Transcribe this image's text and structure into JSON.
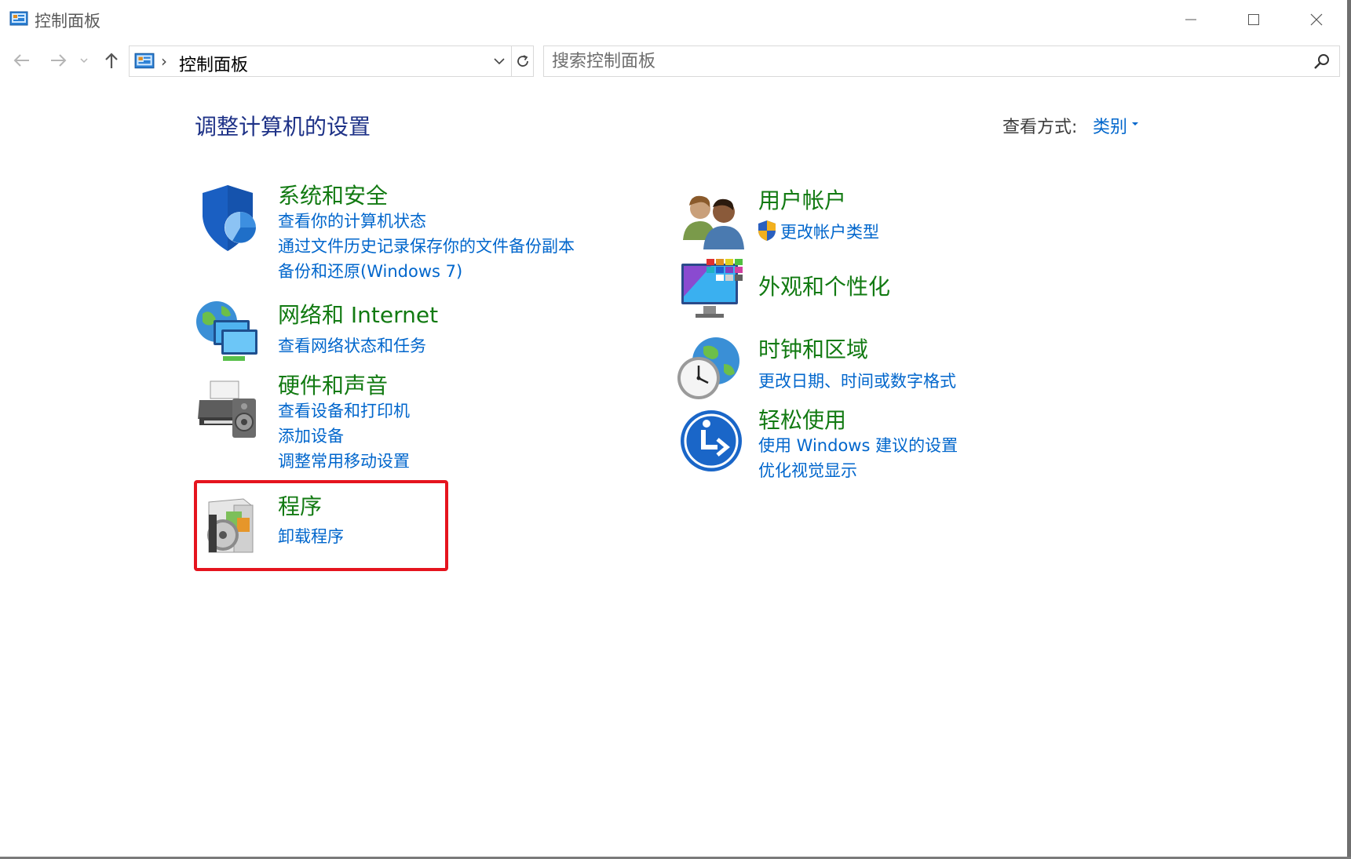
{
  "window": {
    "title": "控制面板",
    "icon": "control-panel-icon"
  },
  "nav": {
    "breadcrumb": "控制面板",
    "search_placeholder": "搜索控制面板"
  },
  "main": {
    "heading": "调整计算机的设置",
    "view_by_label": "查看方式:",
    "view_by_value": "类别"
  },
  "categories": {
    "system_security": {
      "title": "系统和安全",
      "icon": "shield-icon",
      "links": [
        "查看你的计算机状态",
        "通过文件历史记录保存你的文件备份副本",
        "备份和还原(Windows 7)"
      ]
    },
    "network": {
      "title": "网络和 Internet",
      "icon": "network-globe-icon",
      "links": [
        "查看网络状态和任务"
      ]
    },
    "hardware": {
      "title": "硬件和声音",
      "icon": "printer-speaker-icon",
      "links": [
        "查看设备和打印机",
        "添加设备",
        "调整常用移动设置"
      ]
    },
    "programs": {
      "title": "程序",
      "icon": "programs-disc-icon",
      "links": [
        "卸载程序"
      ]
    },
    "user_accounts": {
      "title": "用户帐户",
      "icon": "users-icon",
      "links": [
        "更改帐户类型"
      ]
    },
    "appearance": {
      "title": "外观和个性化",
      "icon": "monitor-palette-icon",
      "links": []
    },
    "clock_region": {
      "title": "时钟和区域",
      "icon": "clock-globe-icon",
      "links": [
        "更改日期、时间或数字格式"
      ]
    },
    "ease_of_access": {
      "title": "轻松使用",
      "icon": "ease-of-access-icon",
      "links": [
        "使用 Windows 建议的设置",
        "优化视觉显示"
      ]
    }
  },
  "annotation": {
    "highlight_color": "#e5141e"
  },
  "colors": {
    "category_title": "#127a12",
    "link": "#0066cc",
    "heading": "#1e3287"
  }
}
